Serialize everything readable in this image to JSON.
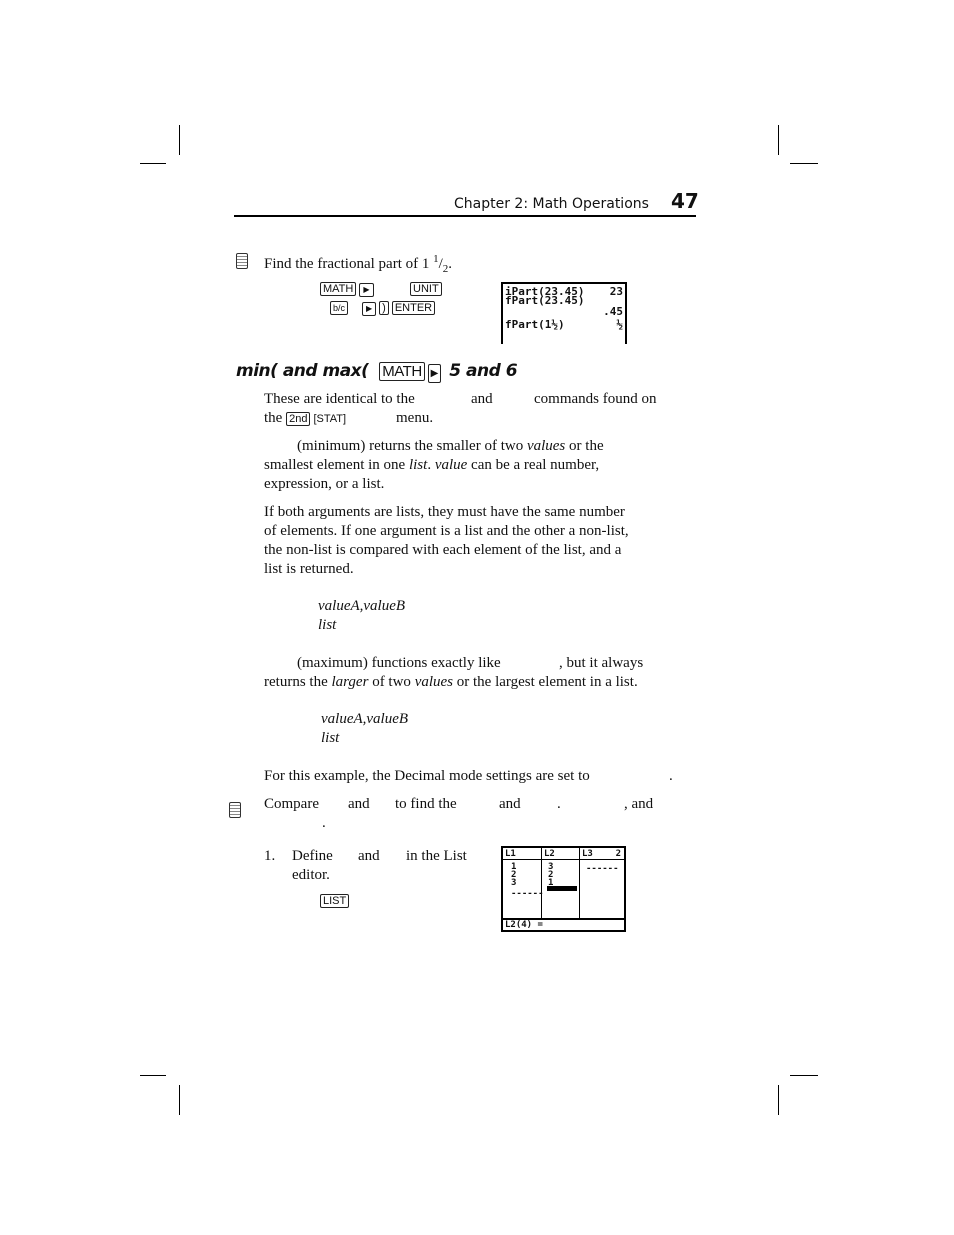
{
  "header": {
    "chapter": "Chapter 2: Math Operations",
    "page_number": "47"
  },
  "example1": {
    "instruction": "Find the fractional part of 1 ",
    "frac_num": "1",
    "frac_den": "2",
    "period": ".",
    "keys_row1": [
      "MATH",
      "right-arrow",
      "UNIT"
    ],
    "keys_row2": [
      "b/c",
      "right-arrow",
      ")",
      "ENTER"
    ],
    "screen": {
      "lines": [
        "iPart(23.45)",
        "fPart(23.45)",
        "fPart(1½)"
      ],
      "results": [
        "23",
        ".45",
        "½"
      ]
    }
  },
  "section": {
    "title": "min( and max(",
    "key_math": "MATH",
    "key_arrow": "right-arrow",
    "suffix": "5 and 6"
  },
  "para1": {
    "a": "These are identical to the",
    "b": "and",
    "c": "commands found on",
    "d": "the",
    "key_2nd": "2nd",
    "key_stat": "[STAT]",
    "e": "menu."
  },
  "para2": {
    "a": "(minimum) returns the smaller of two ",
    "values": "values",
    "b": " or the",
    "c": "smallest element in one ",
    "list": "list",
    "d": ". ",
    "value": "value",
    "e": " can be a real number,",
    "f": "expression, or a list."
  },
  "para3": [
    "If both arguments are lists, they must have the same number",
    "of elements. If one argument is a list and the other a non-list,",
    "the non-list is compared with each element of the list, and a",
    "list is returned."
  ],
  "syntax_min": [
    "valueA,valueB",
    "list"
  ],
  "para4": {
    "a": "(maximum) functions exactly like",
    "b": ", but it always",
    "c": "returns the ",
    "larger": "larger",
    "d": " of two ",
    "values": "values",
    "e": " or the largest element in a list."
  },
  "syntax_max": [
    "valueA,valueB",
    "list"
  ],
  "para5": {
    "a": "For this example, the Decimal mode settings are set to",
    "b": "."
  },
  "example2": {
    "a": "Compare",
    "b": "and",
    "c": "to find the",
    "d": "and",
    "e": ".",
    "f": ", and",
    "g": ".",
    "step_num": "1.",
    "step_a": "Define",
    "step_b": "and",
    "step_c": "in the List",
    "step_d": "editor.",
    "key_list": "LIST",
    "screen": {
      "headers": [
        "L1",
        "L2",
        "L3",
        "2"
      ],
      "l1": [
        "1",
        "2",
        "3"
      ],
      "l2": [
        "3",
        "2",
        "1"
      ],
      "l3": "------",
      "footer": "L2(4) ="
    }
  }
}
